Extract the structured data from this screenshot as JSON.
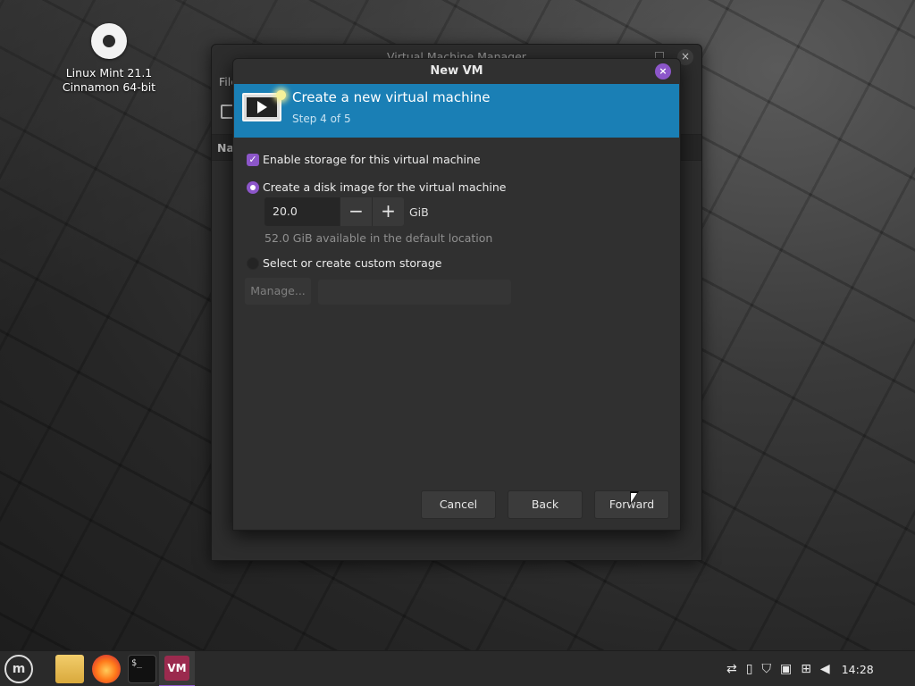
{
  "desktop": {
    "icon_label_line1": "Linux Mint 21.1",
    "icon_label_line2": "Cinnamon 64-bit"
  },
  "main_window": {
    "title": "Virtual Machine Manager",
    "menu_partial": "File",
    "column_partial": "Na",
    "close_symbol": "×"
  },
  "dialog": {
    "title": "New VM",
    "close_symbol": "×",
    "banner": {
      "title": "Create a new virtual machine",
      "step": "Step 4 of 5"
    },
    "enable_storage": {
      "label": "Enable storage for this virtual machine",
      "checked": true,
      "check_symbol": "✓"
    },
    "disk_image_option": {
      "label": "Create a disk image for the virtual machine",
      "selected": true
    },
    "size": {
      "value": "20.0",
      "decrement_symbol": "−",
      "increment_symbol": "+",
      "unit": "GiB"
    },
    "available_text": "52.0 GiB available in the default location",
    "custom_storage_option": {
      "label": "Select or create custom storage",
      "selected": false
    },
    "manage_button": "Manage...",
    "custom_path_value": "",
    "buttons": {
      "cancel": "Cancel",
      "back": "Back",
      "forward": "Forward"
    }
  },
  "taskbar": {
    "menu_symbol": "m",
    "terminal_text": "$_",
    "vm_text": "VM",
    "clock": "14:28"
  },
  "colors": {
    "accent": "#8c56c9",
    "banner": "#1a7fb5"
  }
}
